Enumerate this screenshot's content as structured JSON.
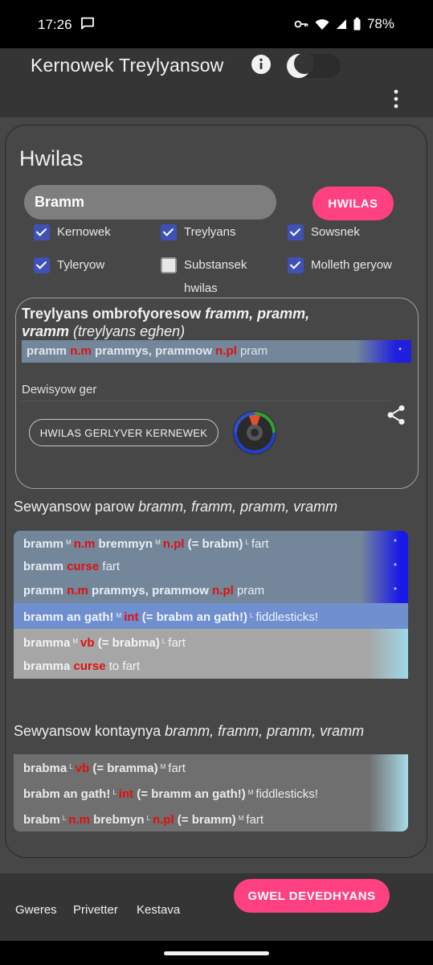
{
  "status": {
    "time": "17:26",
    "battery": "78%"
  },
  "app": {
    "title": "Kernowek Treylyansow"
  },
  "search": {
    "heading": "Hwilas",
    "value": "Bramm",
    "button": "HWILAS",
    "options": [
      {
        "label": "Kernowek",
        "checked": true
      },
      {
        "label": "Treylyans",
        "checked": true
      },
      {
        "label": "Sowsnek",
        "checked": true
      },
      {
        "label": "Tyleryow",
        "checked": true
      },
      {
        "label": "Substansek",
        "checked": false,
        "sub": "hwilas"
      },
      {
        "label": "Molleth geryow",
        "checked": true
      }
    ]
  },
  "definition": {
    "title_a": "Treylyans ombrofyoresow ",
    "title_b": "framm, pramm, vramm",
    "title_c": " (treylyans eghen)",
    "row": {
      "w1": "pramm",
      "p1": "n.m",
      "w2": "prammys, prammow",
      "p2": "n.pl",
      "gloss": "pram",
      "star": "*"
    },
    "options_label": "Dewisyow ger",
    "dict_button": "HWILAS GERLYVER KERNEWEK"
  },
  "pairs": {
    "title_a": "Sewyansow parow ",
    "title_b": "bramm, framm, pramm, vramm",
    "rows": [
      {
        "style": "blue",
        "w1": "bramm",
        "s1": "M",
        "p1": "n.m",
        "w2": "bremmyn",
        "s2": "M",
        "p2": "n.pl",
        "w3": "(= brabm)",
        "s3": "L",
        "gloss": "fart",
        "star": "*"
      },
      {
        "style": "blue",
        "w1": "bramm",
        "p1": "curse",
        "gloss": "fart",
        "star": "*"
      },
      {
        "style": "blue",
        "w1": "pramm",
        "p1": "n.m",
        "w2": "prammys, prammow",
        "p2": "n.pl",
        "gloss": "pram",
        "star": "*"
      },
      {
        "style": "lblue",
        "w1": "bramm an gath!",
        "s1": "M",
        "p1": "int",
        "w2": "(= brabm an gath!)",
        "s2": "L",
        "gloss": "fiddlesticks!"
      },
      {
        "style": "grey",
        "w1": "bramma",
        "s1": "M",
        "p1": "vb",
        "w2": "(= brabma)",
        "s2": "L",
        "gloss": "fart"
      },
      {
        "style": "grey",
        "w1": "bramma",
        "p1": "curse",
        "gloss": "to fart"
      }
    ]
  },
  "contains": {
    "title_a": "Sewyansow kontaynya ",
    "title_b": "bramm, framm, pramm, vramm",
    "rows": [
      {
        "w1": "brabma",
        "s1": "L",
        "p1": "vb",
        "w2": "(= bramma)",
        "s2": "M",
        "gloss": "fart"
      },
      {
        "w1": "brabm an gath!",
        "s1": "L",
        "p1": "int",
        "w2": "(= bramm an gath!)",
        "s2": "M",
        "gloss": "fiddlesticks!"
      },
      {
        "w1": "brabm",
        "s1": "L",
        "p1": "n.m",
        "w2": "brebmyn",
        "s2": "L",
        "p2": "n.pl",
        "w3": "(= bramm)",
        "s3": "M",
        "gloss": "fart"
      }
    ]
  },
  "footer": {
    "links": [
      "Gweres",
      "Privetter",
      "Kestava"
    ],
    "button": "GWEL DEVEDHYANS"
  }
}
